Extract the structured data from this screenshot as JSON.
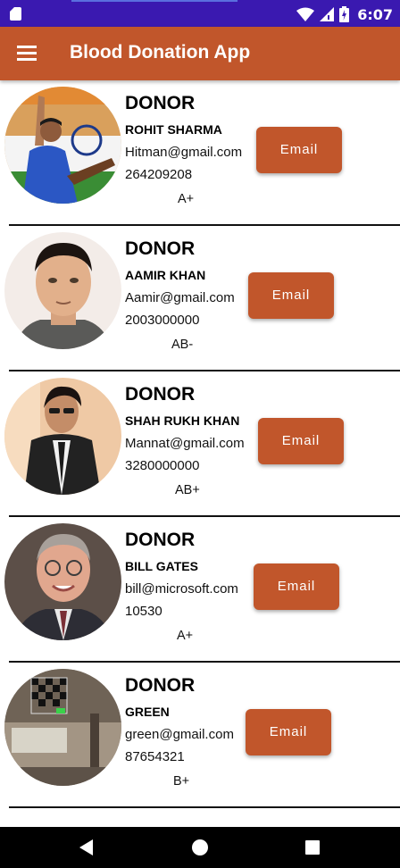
{
  "status_bar": {
    "time": "6:07",
    "colors": {
      "background": "#3a19b0"
    }
  },
  "app_bar": {
    "title": "Blood Donation App",
    "menu_icon": "hamburger-menu-icon",
    "color": "#c1562b"
  },
  "donors": [
    {
      "role": "DONOR",
      "name": "ROHIT SHARMA",
      "email": "Hitman@gmail.com",
      "phone": "264209208",
      "blood_group": "A+",
      "button_label": "Email"
    },
    {
      "role": "DONOR",
      "name": "AAMIR KHAN",
      "email": "Aamir@gmail.com",
      "phone": "2003000000",
      "blood_group": "AB-",
      "button_label": "Email"
    },
    {
      "role": "DONOR",
      "name": "SHAH RUKH KHAN",
      "email": "Mannat@gmail.com",
      "phone": "3280000000",
      "blood_group": "AB+",
      "button_label": "Email"
    },
    {
      "role": "DONOR",
      "name": "BILL GATES",
      "email": "bill@microsoft.com",
      "phone": "10530",
      "blood_group": "A+",
      "button_label": "Email"
    },
    {
      "role": "DONOR",
      "name": "GREEN",
      "email": "green@gmail.com",
      "phone": "87654321",
      "blood_group": "B+",
      "button_label": "Email"
    }
  ],
  "nav_bar": {
    "icons": [
      "back-icon",
      "home-icon",
      "recents-icon"
    ]
  }
}
